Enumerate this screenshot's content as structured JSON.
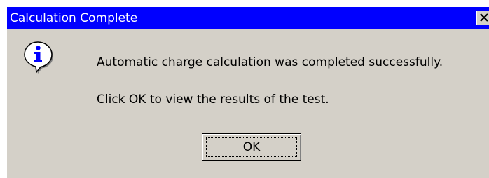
{
  "window": {
    "title": "Calculation Complete",
    "close_icon": "close-icon"
  },
  "dialog": {
    "icon": "info-icon",
    "message_line1": "Automatic charge calculation was completed successfully.",
    "message_line2": "Click OK to view the results of the test.",
    "ok_label": "OK"
  },
  "colors": {
    "titlebar": "#0000ff",
    "dialog_bg": "#d4d0c8",
    "title_text": "#ffffff"
  }
}
